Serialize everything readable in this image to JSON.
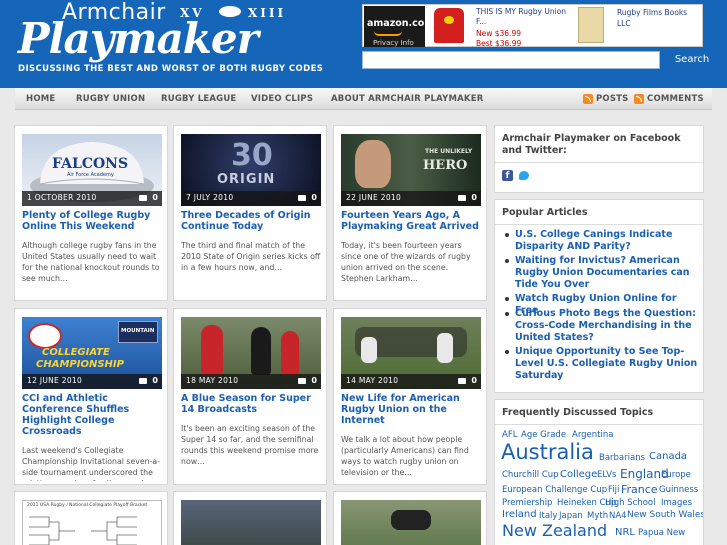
{
  "header": {
    "logo_small": "Armchair",
    "logo_xv": "XV",
    "logo_xiii": "XIII",
    "logo_big": "Playmaker",
    "tagline": "DISCUSSING THE BEST AND WORST OF BOTH RUGBY CODES"
  },
  "ad": {
    "amazon_text": "amazon.com",
    "privacy": "Privacy Info",
    "product1_title": "THIS IS MY Rugby Union F...",
    "product1_price_new": "New $36.99",
    "product1_price_best": "Best $36.99",
    "product2_title": "Rugby Films Books LLC"
  },
  "search": {
    "placeholder": "",
    "button_label": "Search"
  },
  "nav": {
    "items": [
      "HOME",
      "RUGBY UNION",
      "RUGBY LEAGUE",
      "VIDEO CLIPS",
      "ABOUT ARMCHAIR PLAYMAKER"
    ],
    "posts_label": "POSTS",
    "comments_label": "COMMENTS"
  },
  "posts": [
    {
      "date": "1 OCTOBER 2010",
      "comments": "0",
      "title": "Plenty of College Rugby Online This Weekend",
      "excerpt": "Although college rugby fans in the United States usually need to wait for the national knockout rounds to see much…"
    },
    {
      "date": "7 JULY 2010",
      "comments": "0",
      "title": "Three Decades of Origin Continue Today",
      "excerpt": "The third and final match of the 2010 State of Origin series kicks off in a few hours now, and…"
    },
    {
      "date": "22 JUNE 2010",
      "comments": "0",
      "title": "Fourteen Years Ago, A Playmaking Great Arrived",
      "excerpt": "Today, it's been fourteen years since one of the wizards of rugby union arrived on the scene. Stephen Larkham…"
    },
    {
      "date": "12 JUNE 2010",
      "comments": "0",
      "title": "CCI and Athletic Conference Shuffles Highlight College Crossroads",
      "excerpt": "Last weekend's Collegiate Championship Invitational seven-a-side tournament underscored the relative promise of college rugby as the code's most visible presence…"
    },
    {
      "date": "18 MAY 2010",
      "comments": "0",
      "title": "A Blue Season for Super 14 Broadcasts",
      "excerpt": "It's been an exciting season of the Super 14 so far, and the semifinal rounds this weekend promise more now…"
    },
    {
      "date": "14 MAY 2010",
      "comments": "0",
      "title": "New Life for American Rugby Union on the Internet",
      "excerpt": "We talk a lot about how people (particularly Americans) can find ways to watch rugby union on television or the…"
    }
  ],
  "thumb_text": {
    "falcons": "FALCONS",
    "air_force": "Air Force Academy",
    "origin_30": "30",
    "origin_word": "ORIGIN",
    "unlikely": "THE UNLIKELY",
    "hero": "HERO",
    "collegiate": "COLLEGIATE",
    "championship": "CHAMPIONSHIP",
    "mountain": "MOUNTAIN",
    "bracket_title": "2011 USA Rugby / National Collegiate Playoff Bracket"
  },
  "sidebar": {
    "facebook_title": "Armchair Playmaker on Facebook and Twitter:",
    "popular_title": "Popular Articles",
    "popular": [
      "U.S. College Canings Indicate Disparity AND Parity?",
      "Waiting for Invictus? American Rugby Union Documentaries can Tide You Over",
      "Watch Rugby Union Online for Free",
      "Curious Photo Begs the Question: Cross-Code Merchandising in the United States?",
      "Unique Opportunity to See Top-Level U.S. Collegiate Rugby Union Saturday"
    ],
    "topics_title": "Frequently Discussed Topics",
    "tags": [
      "AFL",
      "Age Grade",
      "Argentina",
      "Australia",
      "Barbarians",
      "Canada",
      "Churchill Cup",
      "College",
      "ELVs",
      "England",
      "Europe",
      "European Challenge Cup",
      "Fiji",
      "France",
      "Guinness",
      "Premiership",
      "Heineken Cup",
      "High School",
      "Images",
      "Ireland",
      "Italy",
      "Japan",
      "Myth",
      "NA4",
      "New South Wales",
      "New Zealand",
      "NRL",
      "Papua New"
    ]
  },
  "colors": {
    "header_blue": "#1565b8",
    "link_blue": "#1b5fb0"
  }
}
